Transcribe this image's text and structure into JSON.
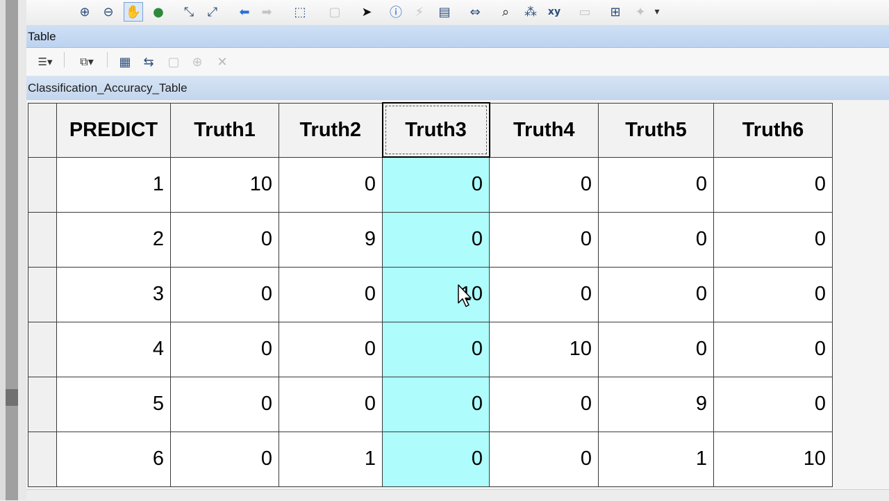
{
  "window": {
    "title": "Table"
  },
  "toolbar": {
    "buttons": [
      {
        "icon": "zoom-in-icon",
        "glyph": "⊕"
      },
      {
        "icon": "zoom-out-icon",
        "glyph": "⊖"
      },
      {
        "icon": "pan-hand-icon",
        "glyph": "✋"
      },
      {
        "icon": "full-extent-globe-icon",
        "glyph": "●"
      },
      {
        "icon": "fixed-zoom-in-icon",
        "glyph": "⤡"
      },
      {
        "icon": "fixed-zoom-out-icon",
        "glyph": "⤢"
      },
      {
        "icon": "back-arrow-icon",
        "glyph": "⬅"
      },
      {
        "icon": "forward-arrow-icon",
        "glyph": "➡"
      },
      {
        "icon": "select-features-icon",
        "glyph": "⬚"
      },
      {
        "icon": "clear-selection-icon",
        "glyph": "▢"
      },
      {
        "icon": "select-elements-pointer-icon",
        "glyph": "➤"
      },
      {
        "icon": "identify-info-icon",
        "glyph": "ⓘ"
      },
      {
        "icon": "hyperlink-lightning-icon",
        "glyph": "⚡"
      },
      {
        "icon": "html-popup-icon",
        "glyph": "▤"
      },
      {
        "icon": "measure-icon",
        "glyph": "⇔"
      },
      {
        "icon": "find-binoculars-icon",
        "glyph": "⌕"
      },
      {
        "icon": "find-route-icon",
        "glyph": "⁂"
      },
      {
        "icon": "go-to-xy-icon",
        "glyph": "xy"
      },
      {
        "icon": "time-slider-icon",
        "glyph": "▭"
      },
      {
        "icon": "create-viewer-window-icon",
        "glyph": "⊞"
      },
      {
        "icon": "pushpin-icon",
        "glyph": "✦"
      },
      {
        "icon": "toolbar-overflow-icon",
        "glyph": "▾"
      }
    ]
  },
  "table_toolbar": {
    "buttons": [
      {
        "icon": "table-options-icon",
        "glyph": "☰▾"
      },
      {
        "icon": "related-tables-icon",
        "glyph": "⧉▾"
      },
      {
        "icon": "select-by-attributes-icon",
        "glyph": "▦"
      },
      {
        "icon": "switch-selection-icon",
        "glyph": "⇆"
      },
      {
        "icon": "clear-selection-icon",
        "glyph": "▢"
      },
      {
        "icon": "zoom-to-selected-icon",
        "glyph": "⊕"
      },
      {
        "icon": "delete-selected-icon",
        "glyph": "✕"
      }
    ]
  },
  "tab": {
    "name": "Classification_Accuracy_Table"
  },
  "table": {
    "headers": [
      "PREDICT",
      "Truth1",
      "Truth2",
      "Truth3",
      "Truth4",
      "Truth5",
      "Truth6"
    ],
    "selected_column": "Truth3",
    "highlight_color": "#aefcfc",
    "rows": [
      [
        "1",
        "10",
        "0",
        "0",
        "0",
        "0",
        "0"
      ],
      [
        "2",
        "0",
        "9",
        "0",
        "0",
        "0",
        "0"
      ],
      [
        "3",
        "0",
        "0",
        "10",
        "0",
        "0",
        "0"
      ],
      [
        "4",
        "0",
        "0",
        "0",
        "10",
        "0",
        "0"
      ],
      [
        "5",
        "0",
        "0",
        "0",
        "0",
        "9",
        "0"
      ],
      [
        "6",
        "0",
        "1",
        "0",
        "0",
        "1",
        "10"
      ]
    ]
  }
}
